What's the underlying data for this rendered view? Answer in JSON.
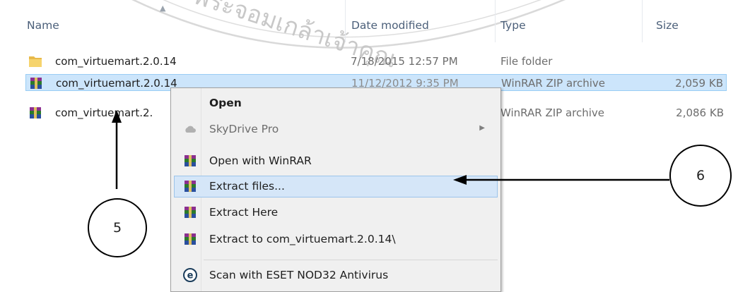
{
  "columns": {
    "name": "Name",
    "date": "Date modified",
    "type": "Type",
    "size": "Size"
  },
  "files": [
    {
      "name": "com_virtuemart.2.0.14",
      "date": "7/18/2015 12:57 PM",
      "type": "File folder",
      "size": "",
      "icon": "folder-icon"
    },
    {
      "name": "com_virtuemart.2.0.14",
      "date": "11/12/2012 9:35 PM",
      "type": "WinRAR ZIP archive",
      "size": "2,059 KB",
      "icon": "winrar-icon"
    },
    {
      "name": "com_virtuemart.2.",
      "date": "",
      "type": "WinRAR ZIP archive",
      "size": "2,086 KB",
      "icon": "winrar-icon"
    }
  ],
  "menu": {
    "open": "Open",
    "skydrive": "SkyDrive Pro",
    "open_winrar": "Open with WinRAR",
    "extract_files": "Extract files...",
    "extract_here": "Extract Here",
    "extract_to": "Extract to com_virtuemart.2.0.14\\",
    "scan": "Scan with ESET NOD32 Antivirus"
  },
  "callouts": {
    "five": "5",
    "six": "6"
  },
  "watermark_text": "พระจอมเกล้าเจ้าคุณ",
  "colors": {
    "selection": "#cce5fb",
    "highlight": "#d5e6f8",
    "header_text": "#4c607a"
  }
}
